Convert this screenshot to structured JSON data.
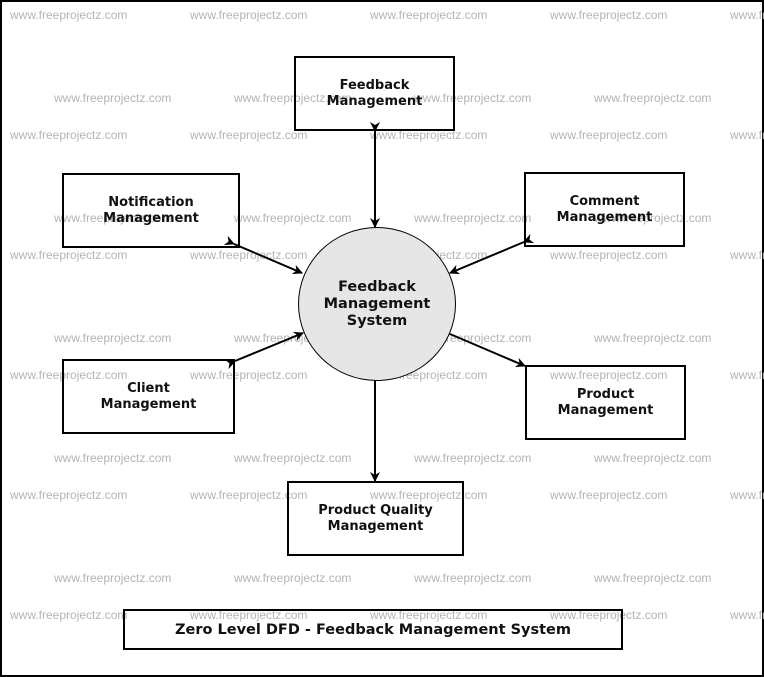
{
  "diagram": {
    "title": "Zero Level DFD - Feedback Management System",
    "watermark": "www.freeprojectz.com",
    "central_process": {
      "id": "feedback-management-system",
      "label": "Feedback\nManagement\nSystem",
      "fill": "#e6e6e6"
    },
    "entities": [
      {
        "id": "feedback-management",
        "label": "Feedback\nManagement"
      },
      {
        "id": "notification-management",
        "label": "Notification\nManagement"
      },
      {
        "id": "comment-management",
        "label": "Comment\nManagement"
      },
      {
        "id": "client-management",
        "label": "Client\nManagement"
      },
      {
        "id": "product-management",
        "label": "Product\nManagement"
      },
      {
        "id": "product-quality-management",
        "label": "Product Quality\nManagement"
      }
    ],
    "flows": [
      {
        "from": "feedback-management",
        "to": "feedback-management-system",
        "direction": "bidirectional"
      },
      {
        "from": "notification-management",
        "to": "feedback-management-system",
        "direction": "bidirectional"
      },
      {
        "from": "comment-management",
        "to": "feedback-management-system",
        "direction": "bidirectional"
      },
      {
        "from": "client-management",
        "to": "feedback-management-system",
        "direction": "bidirectional"
      },
      {
        "from": "product-management",
        "to": "feedback-management-system",
        "direction": "bidirectional"
      },
      {
        "from": "product-quality-management",
        "to": "feedback-management-system",
        "direction": "bidirectional"
      }
    ]
  }
}
